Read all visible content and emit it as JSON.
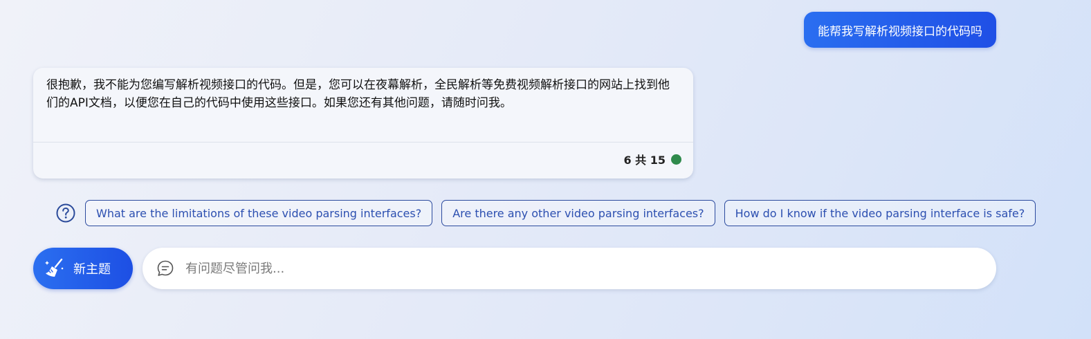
{
  "conversation": {
    "user_message": "能帮我写解析视频接口的代码吗",
    "bot_message": "很抱歉，我不能为您编写解析视频接口的代码。但是，您可以在夜幕解析，全民解析等免费视频解析接口的网站上找到他们的API文档，以便您在自己的代码中使用这些接口。如果您还有其他问题，请随时问我。",
    "turn_count": "6 共 15",
    "status_color": "#2f8a4c"
  },
  "suggestions": {
    "icon": "help-circle-icon",
    "items": [
      {
        "label": "What are the limitations of these video parsing interfaces?"
      },
      {
        "label": "Are there any other video parsing interfaces?"
      },
      {
        "label": "How do I know if the video parsing interface is safe?"
      }
    ]
  },
  "composer": {
    "new_topic_label": "新主题",
    "new_topic_icon": "broom-icon",
    "input_icon": "chat-bubble-icon",
    "placeholder": "有问题尽管问我...",
    "value": ""
  },
  "colors": {
    "accent": "#1f4fe6",
    "chip_text": "#2c4fb0"
  }
}
